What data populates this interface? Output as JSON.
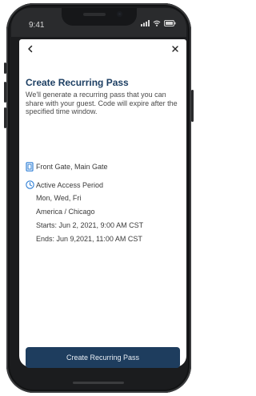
{
  "status_bar": {
    "time": "9:41",
    "icons": [
      "signal-icon",
      "wifi-icon",
      "battery-icon"
    ]
  },
  "nav": {
    "back_icon": "chevron-left-icon",
    "close_icon": "close-icon"
  },
  "page": {
    "title": "Create Recurring Pass",
    "description": "We'll generate a recurring pass that you can share with your guest. Code will expire after the specified time window."
  },
  "gate": {
    "icon": "gate-icon",
    "label": "Front Gate, Main Gate"
  },
  "access_period": {
    "icon": "clock-icon",
    "label": "Active Access Period",
    "days": "Mon, Wed, Fri",
    "timezone": "America / Chicago",
    "starts": "Starts: Jun 2, 2021, 9:00 AM CST",
    "ends": "Ends: Jun 9,2021, 11:00 AM CST"
  },
  "cta": {
    "label": "Create Recurring Pass"
  },
  "colors": {
    "title": "#1d3f63",
    "accent": "#2f7fd6",
    "button": "#1e3d5e"
  }
}
